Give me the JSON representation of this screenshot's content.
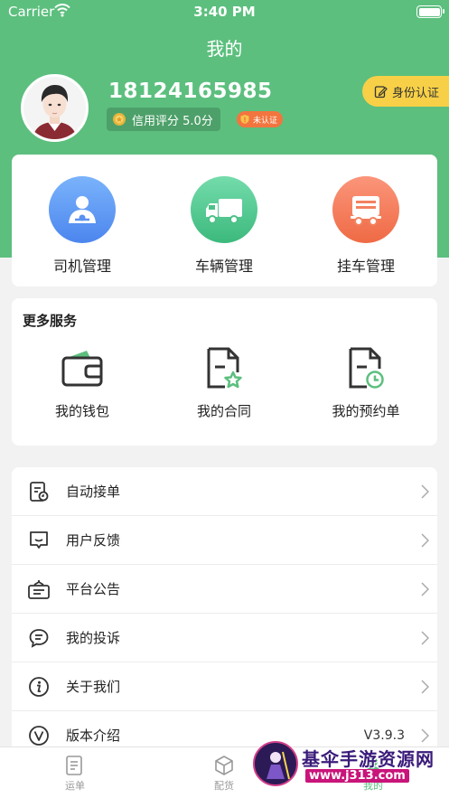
{
  "status_bar": {
    "carrier": "Carrier",
    "time": "3:40 PM"
  },
  "nav": {
    "title": "我的"
  },
  "profile": {
    "phone": "18124165985",
    "credit_label": "信用评分 5.0分",
    "verify_badge": "未认证",
    "id_button": "身份认证"
  },
  "quick_actions": [
    {
      "label": "司机管理",
      "icon": "driver-icon",
      "color": "#5b9af5"
    },
    {
      "label": "车辆管理",
      "icon": "truck-icon",
      "color": "#47c48a"
    },
    {
      "label": "挂车管理",
      "icon": "trailer-icon",
      "color": "#f2764d"
    }
  ],
  "services": {
    "title": "更多服务",
    "items": [
      {
        "label": "我的钱包",
        "icon": "wallet-icon"
      },
      {
        "label": "我的合同",
        "icon": "contract-icon"
      },
      {
        "label": "我的预约单",
        "icon": "reservation-icon"
      }
    ]
  },
  "menu": [
    {
      "label": "自动接单",
      "icon": "auto-order-icon",
      "value": ""
    },
    {
      "label": "用户反馈",
      "icon": "feedback-icon",
      "value": ""
    },
    {
      "label": "平台公告",
      "icon": "announcement-icon",
      "value": ""
    },
    {
      "label": "我的投诉",
      "icon": "complaint-icon",
      "value": ""
    },
    {
      "label": "关于我们",
      "icon": "info-icon",
      "value": ""
    },
    {
      "label": "版本介绍",
      "icon": "version-icon",
      "value": "V3.9.3"
    }
  ],
  "tabbar": [
    {
      "label": "运单",
      "icon": "waybill-icon",
      "active": false
    },
    {
      "label": "配货",
      "icon": "cargo-box-icon",
      "active": false
    },
    {
      "label": "我的",
      "icon": "profile-icon",
      "active": true
    }
  ],
  "watermark": {
    "title": "基伞手游资源网",
    "url": "www.j313.com"
  },
  "colors": {
    "brand_green": "#5cbf7e",
    "badge_orange": "#f2753f",
    "id_yellow": "#f7d047"
  }
}
